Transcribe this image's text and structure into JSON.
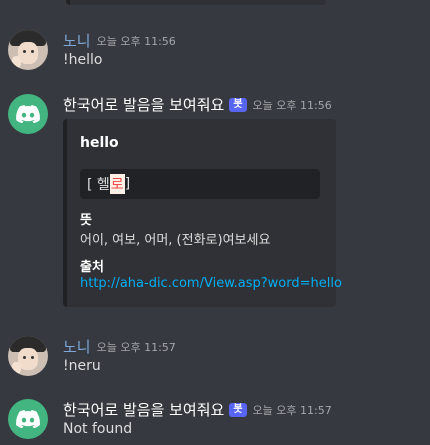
{
  "messages": [
    {
      "author": "노니",
      "time": "오늘 오후 11:56",
      "text": "!hello"
    },
    {
      "author": "한국어로 발음을 보여줘요",
      "bot_tag": "봇",
      "time": "오늘 오후 11:56",
      "embed": {
        "title": "hello",
        "pron_left": "[ 헬",
        "pron_hl": "로",
        "pron_right": "]",
        "field1_name": "뜻",
        "field1_value": "어이, 여보, 어머, (전화로)여보세요",
        "field2_name": "출처",
        "field2_value": "http://aha-dic.com/View.asp?word=hello"
      }
    },
    {
      "author": "노니",
      "time": "오늘 오후 11:57",
      "text": "!neru"
    },
    {
      "author": "한국어로 발음을 보여줘요",
      "bot_tag": "봇",
      "time": "오늘 오후 11:57",
      "text": "Not found"
    }
  ],
  "colors": {
    "background": "#36393f",
    "embed_background": "#2f3136",
    "user_name": "#7ea7d8",
    "bot_avatar": "#43b581",
    "bot_tag": "#5865f2",
    "link": "#00aff4"
  },
  "icons": {
    "bot_avatar": "discord-logo-icon",
    "user_avatar": "user-photo-avatar"
  }
}
